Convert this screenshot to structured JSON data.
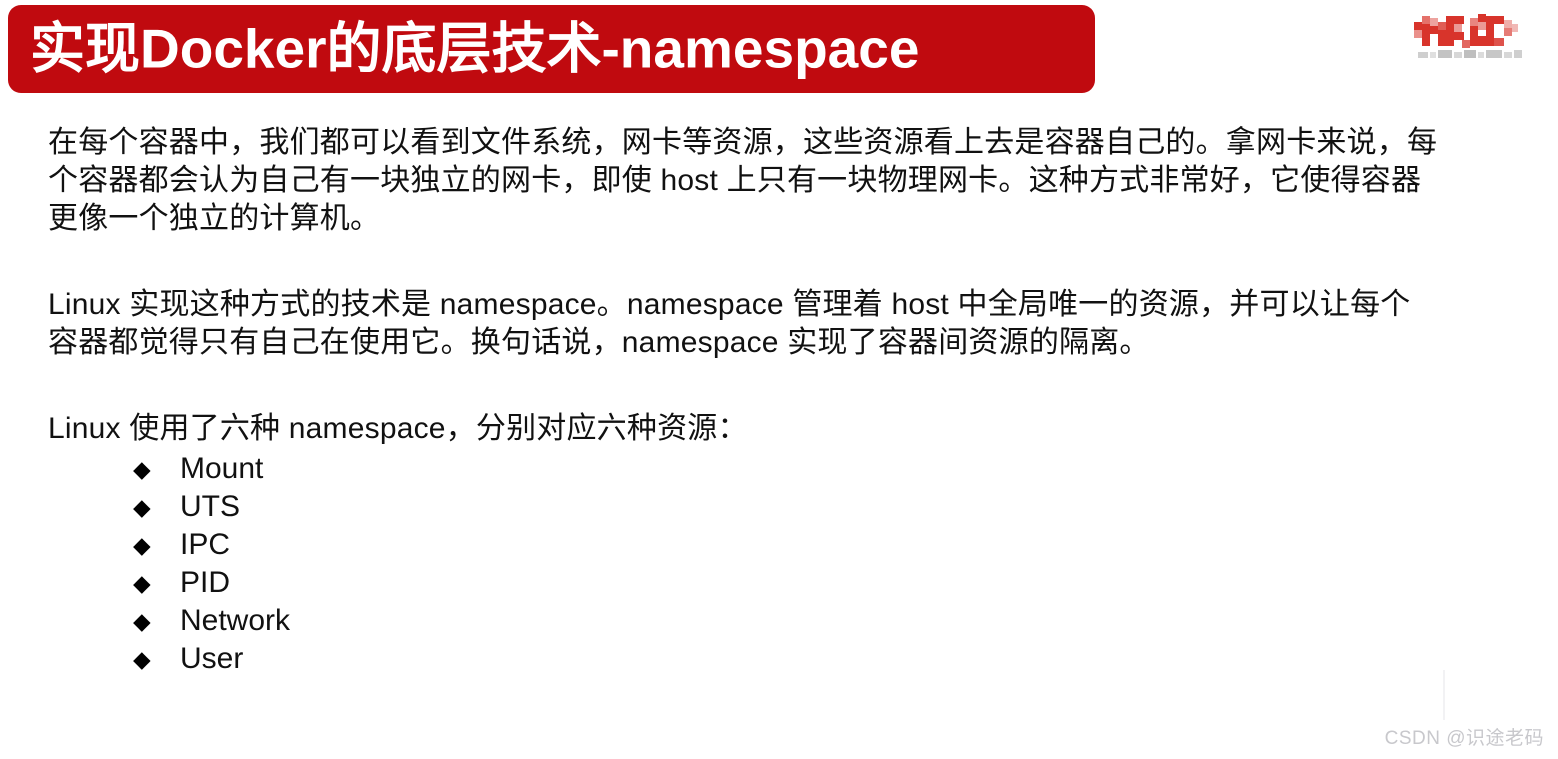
{
  "slide": {
    "title": "实现Docker的底层技术-namespace",
    "title_bg_color": "#C00A0F",
    "title_text_color": "#FFFFFF",
    "background_color": "#FFFFFF"
  },
  "logo": {
    "name": "mosaic-logo",
    "primary_color": "#D8342B",
    "secondary_color": "#B0B0B0"
  },
  "paragraphs": [
    {
      "id": "para-1",
      "lines": [
        "在每个容器中，我们都可以看到文件系统，网卡等资源，这些资源看上去是容器自己的。拿网卡来说，每",
        "个容器都会认为自己有一块独立的网卡，即使 host 上只有一块物理网卡。这种方式非常好，它使得容器",
        "更像一个独立的计算机。"
      ]
    },
    {
      "id": "para-2",
      "lines": [
        "Linux 实现这种方式的技术是 namespace。namespace 管理着 host 中全局唯一的资源，并可以让每个",
        "容器都觉得只有自己在使用它。换句话说，namespace 实现了容器间资源的隔离。"
      ]
    },
    {
      "id": "para-3",
      "lines": [
        "Linux 使用了六种 namespace，分别对应六种资源："
      ]
    }
  ],
  "bullets": {
    "marker": "◆",
    "items": [
      {
        "label": "Mount"
      },
      {
        "label": "UTS"
      },
      {
        "label": "IPC"
      },
      {
        "label": "PID"
      },
      {
        "label": "Network"
      },
      {
        "label": "User"
      }
    ]
  },
  "watermark": {
    "text": "CSDN @识途老码",
    "color": "#C8C8CC"
  }
}
